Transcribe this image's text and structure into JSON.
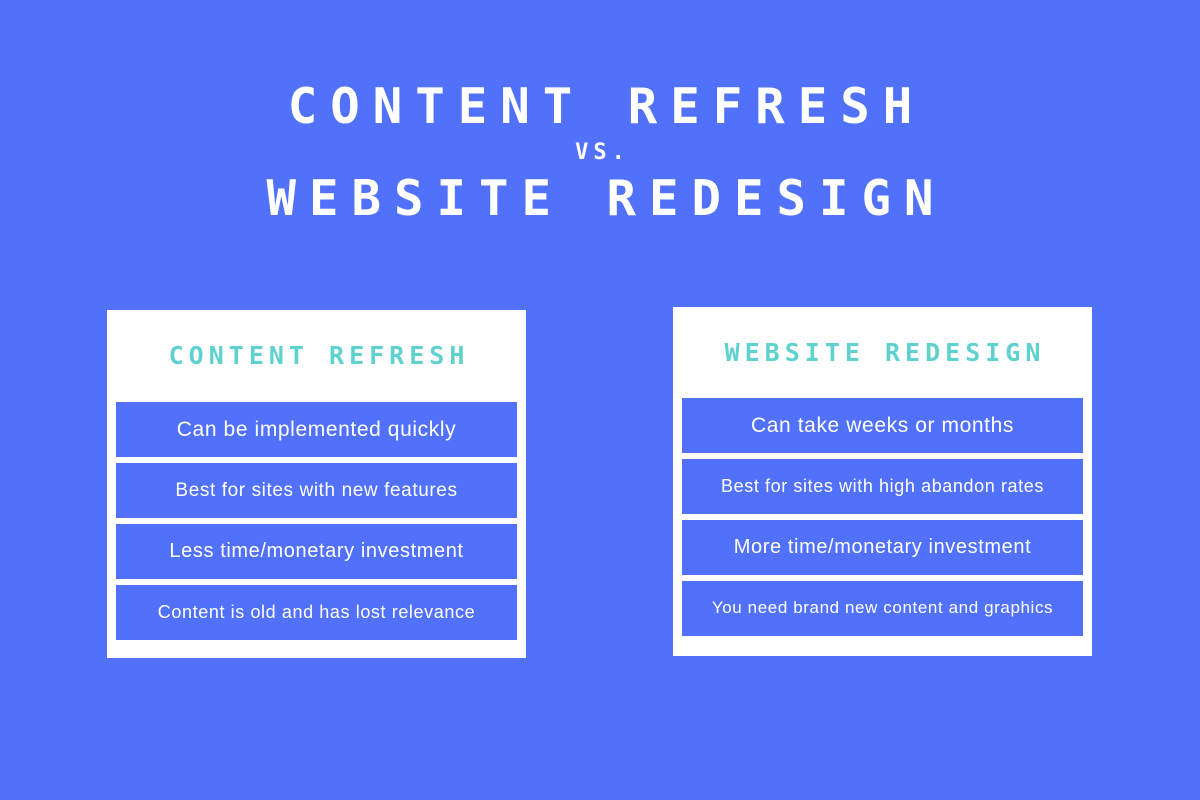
{
  "theme": {
    "background": "#5271fb",
    "card_background": "#ffffff",
    "header_text": "#5fd2d0",
    "row_background": "#5271fb",
    "row_text": "#ffffff",
    "title_text": "#ffffff"
  },
  "title": {
    "line1": "CONTENT REFRESH",
    "separator": "vs.",
    "line2": "WEBSITE REDESIGN"
  },
  "cards": [
    {
      "header": "CONTENT REFRESH",
      "rows": [
        "Can be implemented quickly",
        "Best for sites with new features",
        "Less time/monetary investment",
        "Content is old and has lost relevance"
      ]
    },
    {
      "header": "WEBSITE REDESIGN",
      "rows": [
        "Can take weeks or months",
        "Best for sites with high abandon rates",
        "More time/monetary investment",
        "You need brand new content and graphics"
      ]
    }
  ]
}
